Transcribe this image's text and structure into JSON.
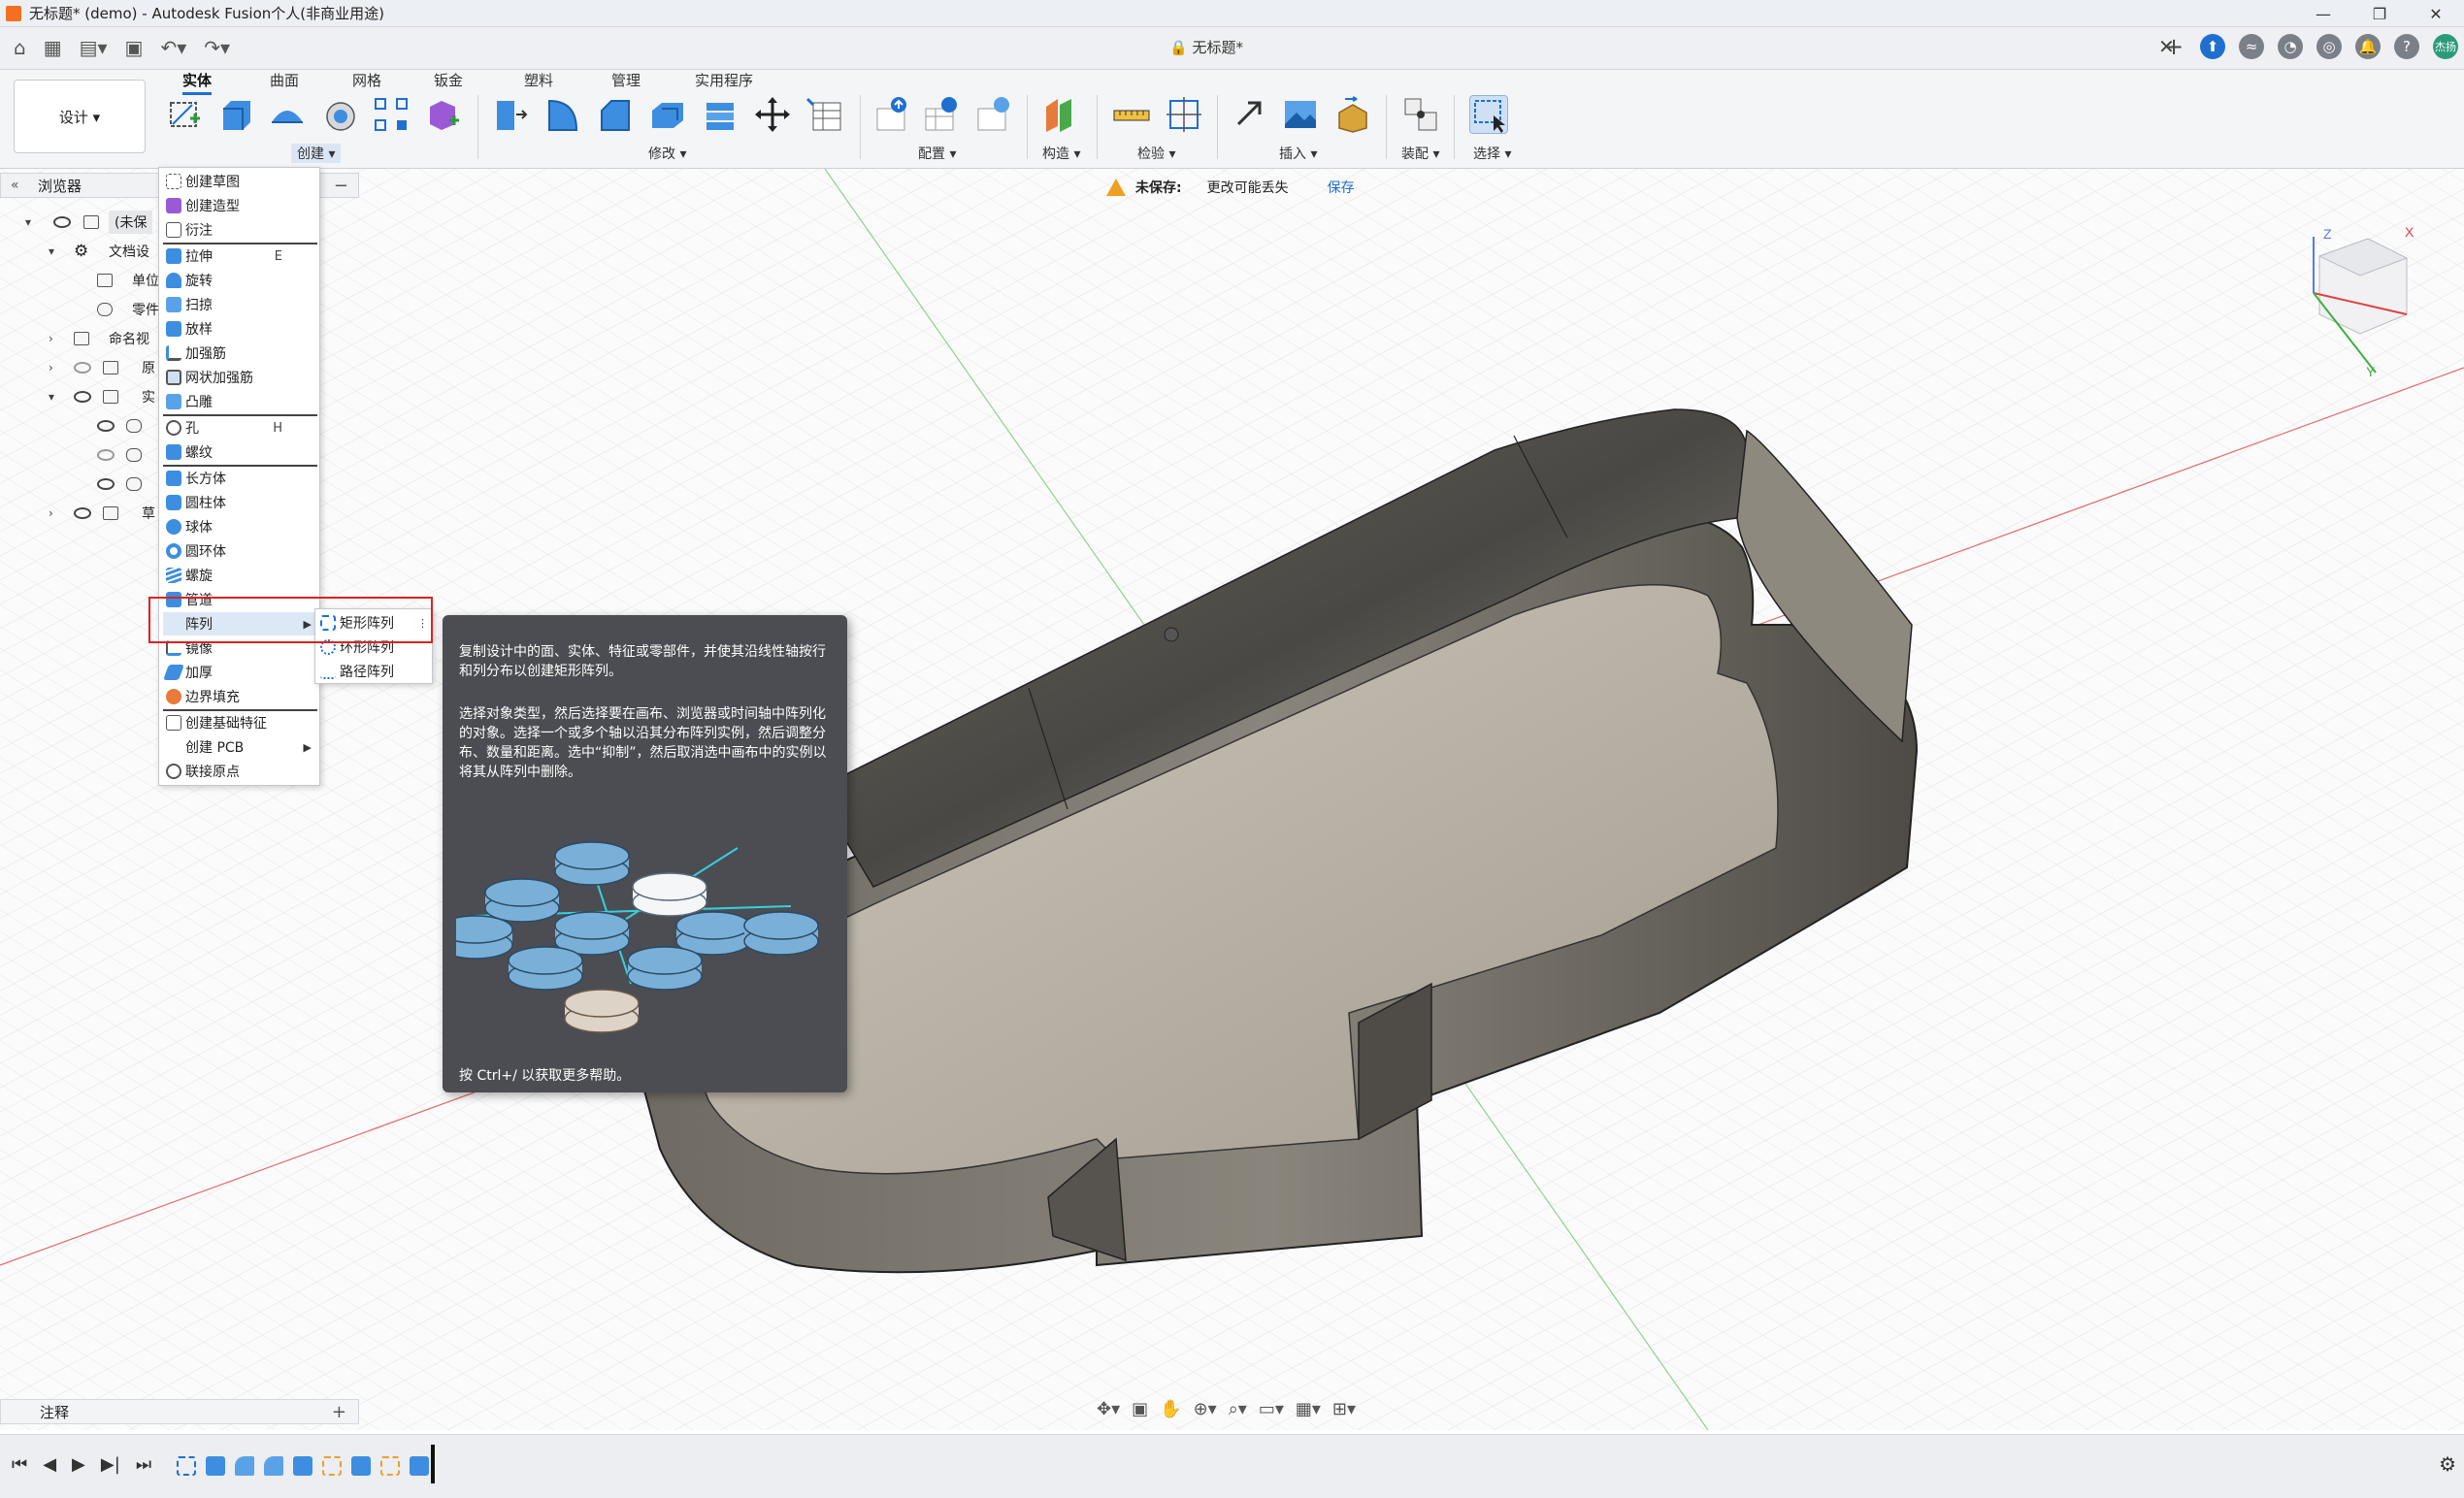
{
  "window": {
    "title": "无标题* (demo) - Autodesk Fusion个人(非商业用途)",
    "minimize": "—",
    "maximize": "❐",
    "close": "✕"
  },
  "tabbar": {
    "doc_tab": "无标题*",
    "doc_close": "✕",
    "avatar_text": "杰扬"
  },
  "ribbon": {
    "workspace_button": "设计 ▾",
    "tabs": [
      "实体",
      "曲面",
      "网格",
      "钣金",
      "塑料",
      "管理",
      "实用程序"
    ],
    "active_tab": "实体",
    "groups": [
      "创建 ▾",
      "修改 ▾",
      "配置 ▾",
      "构造 ▾",
      "检验 ▾",
      "插入 ▾",
      "装配 ▾",
      "选择 ▾"
    ]
  },
  "browser": {
    "title": "浏览器",
    "collapse_icon": "«",
    "minimize_icon": "−",
    "rows": [
      "(未保",
      "文档设",
      "单位",
      "零件",
      "命名视",
      "原",
      "实",
      "草"
    ]
  },
  "notice": {
    "label": "未保存:",
    "message": "更改可能丢失",
    "save_link": "保存"
  },
  "create_menu": {
    "items": [
      {
        "label": "创建草图",
        "shortcut": ""
      },
      {
        "label": "创建造型",
        "shortcut": ""
      },
      {
        "label": "衍注",
        "shortcut": ""
      },
      {
        "label": "拉伸",
        "shortcut": "E"
      },
      {
        "label": "旋转",
        "shortcut": ""
      },
      {
        "label": "扫掠",
        "shortcut": ""
      },
      {
        "label": "放样",
        "shortcut": ""
      },
      {
        "label": "加强筋",
        "shortcut": ""
      },
      {
        "label": "网状加强筋",
        "shortcut": ""
      },
      {
        "label": "凸雕",
        "shortcut": ""
      },
      {
        "label": "孔",
        "shortcut": "H"
      },
      {
        "label": "螺纹",
        "shortcut": ""
      },
      {
        "label": "长方体",
        "shortcut": ""
      },
      {
        "label": "圆柱体",
        "shortcut": ""
      },
      {
        "label": "球体",
        "shortcut": ""
      },
      {
        "label": "圆环体",
        "shortcut": ""
      },
      {
        "label": "螺旋",
        "shortcut": ""
      },
      {
        "label": "管道",
        "shortcut": ""
      },
      {
        "label": "阵列",
        "shortcut": ""
      },
      {
        "label": "镜像",
        "shortcut": ""
      },
      {
        "label": "加厚",
        "shortcut": ""
      },
      {
        "label": "边界填充",
        "shortcut": ""
      },
      {
        "label": "创建基础特征",
        "shortcut": ""
      },
      {
        "label": "创建 PCB",
        "shortcut": ""
      },
      {
        "label": "联接原点",
        "shortcut": ""
      }
    ]
  },
  "pattern_submenu": {
    "items": [
      "矩形阵列",
      "环形阵列",
      "路径阵列"
    ],
    "more_icon": "⋮"
  },
  "tooltip": {
    "paragraph1": "复制设计中的面、实体、特征或零部件，并使其沿线性轴按行和列分布以创建矩形阵列。",
    "paragraph2": "选择对象类型，然后选择要在画布、浏览器或时间轴中阵列化的对象。选择一个或多个轴以沿其分布阵列实例，然后调整分布、数量和距离。选中“抑制”，然后取消选中画布中的实例以将其从阵列中删除。",
    "help": "按 Ctrl+/ 以获取更多帮助。"
  },
  "comments": {
    "label": "注释",
    "add_icon": "+"
  },
  "colors": {
    "accent": "#1f6fd1",
    "tooltip_bg": "#4b4d52",
    "highlight_box": "#e02020",
    "model_dark": "#4a4844",
    "model_floor": "#b8b1a6"
  }
}
